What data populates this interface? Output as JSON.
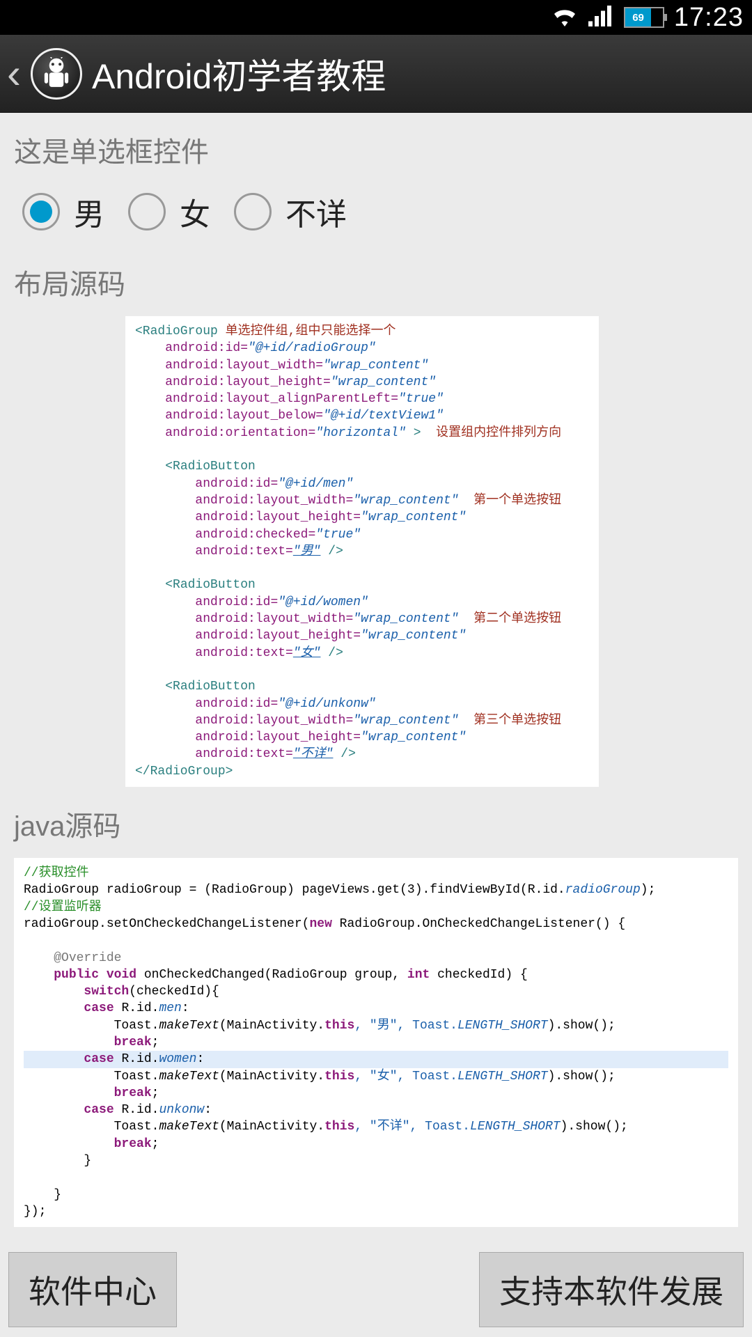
{
  "status": {
    "battery_pct": "69",
    "time": "17:23"
  },
  "appbar": {
    "title": "Android初学者教程"
  },
  "section1": {
    "label": "这是单选框控件",
    "radios": [
      {
        "label": "男",
        "checked": true
      },
      {
        "label": "女",
        "checked": false
      },
      {
        "label": "不详",
        "checked": false
      }
    ]
  },
  "section2": {
    "label": "布局源码"
  },
  "section3": {
    "label": "java源码"
  },
  "xml": {
    "rg_open": "<RadioGroup",
    "rg_note1": "单选控件组,组中只能选择一个",
    "rg_id": "android:id=",
    "rg_id_v": "\"@+id/radioGroup\"",
    "lw": "android:layout_width=",
    "lh": "android:layout_height=",
    "wrap": "\"wrap_content\"",
    "apl": "android:layout_alignParentLeft=",
    "apl_v": "\"true\"",
    "below": "android:layout_below=",
    "below_v": "\"@+id/textView1\"",
    "orient": "android:orientation=",
    "orient_v": "\"horizontal\"",
    "rg_note2": "设置组内控件排列方向",
    "rb_open": "<RadioButton",
    "id": "android:id=",
    "men_v": "\"@+id/men\"",
    "women_v": "\"@+id/women\"",
    "unk_v": "\"@+id/unkonw\"",
    "checked": "android:checked=",
    "true_v": "\"true\"",
    "text": "android:text=",
    "text_m": "\"男\"",
    "text_w": "\"女\"",
    "text_u": "\"不详\"",
    "close": " />",
    "rg_close": "</RadioGroup>",
    "note_rb1": "第一个单选按钮",
    "note_rb2": "第二个单选按钮",
    "note_rb3": "第三个单选按钮",
    "gt": " >"
  },
  "java": {
    "c1": "//获取控件",
    "l1a": "RadioGroup radioGroup = (RadioGroup) pageViews.get(3).findViewById(R.id.",
    "l1b": "radioGroup",
    "l1c": ");",
    "c2": "//设置监听器",
    "l2a": "radioGroup.setOnCheckedChangeListener(",
    "l2b": "new",
    "l2c": " RadioGroup.OnCheckedChangeListener() {",
    "ov": "@Override",
    "m1a": "public void",
    "m1b": " onCheckedChanged(RadioGroup group, ",
    "m1c": "int",
    "m1d": " checkedId) {",
    "sw": "switch",
    "sw2": "(checkedId){",
    "case": "case",
    "rid": " R.id.",
    "men": "men",
    "women": "women",
    "unkonw": "unkonw",
    "colon": ":",
    "toast1": "    Toast.",
    "make": "makeText",
    "toast2": "(MainActivity.",
    "this": "this",
    "tm": ", \"男\", Toast.",
    "tw": ", \"女\", Toast.",
    "tu": ", \"不详\", Toast.",
    "ls": "LENGTH_SHORT",
    "show": ").show();",
    "break": "break",
    "semi": ";",
    "cb": "}",
    "end": "});"
  },
  "buttons": {
    "left": "软件中心",
    "right": "支持本软件发展"
  }
}
